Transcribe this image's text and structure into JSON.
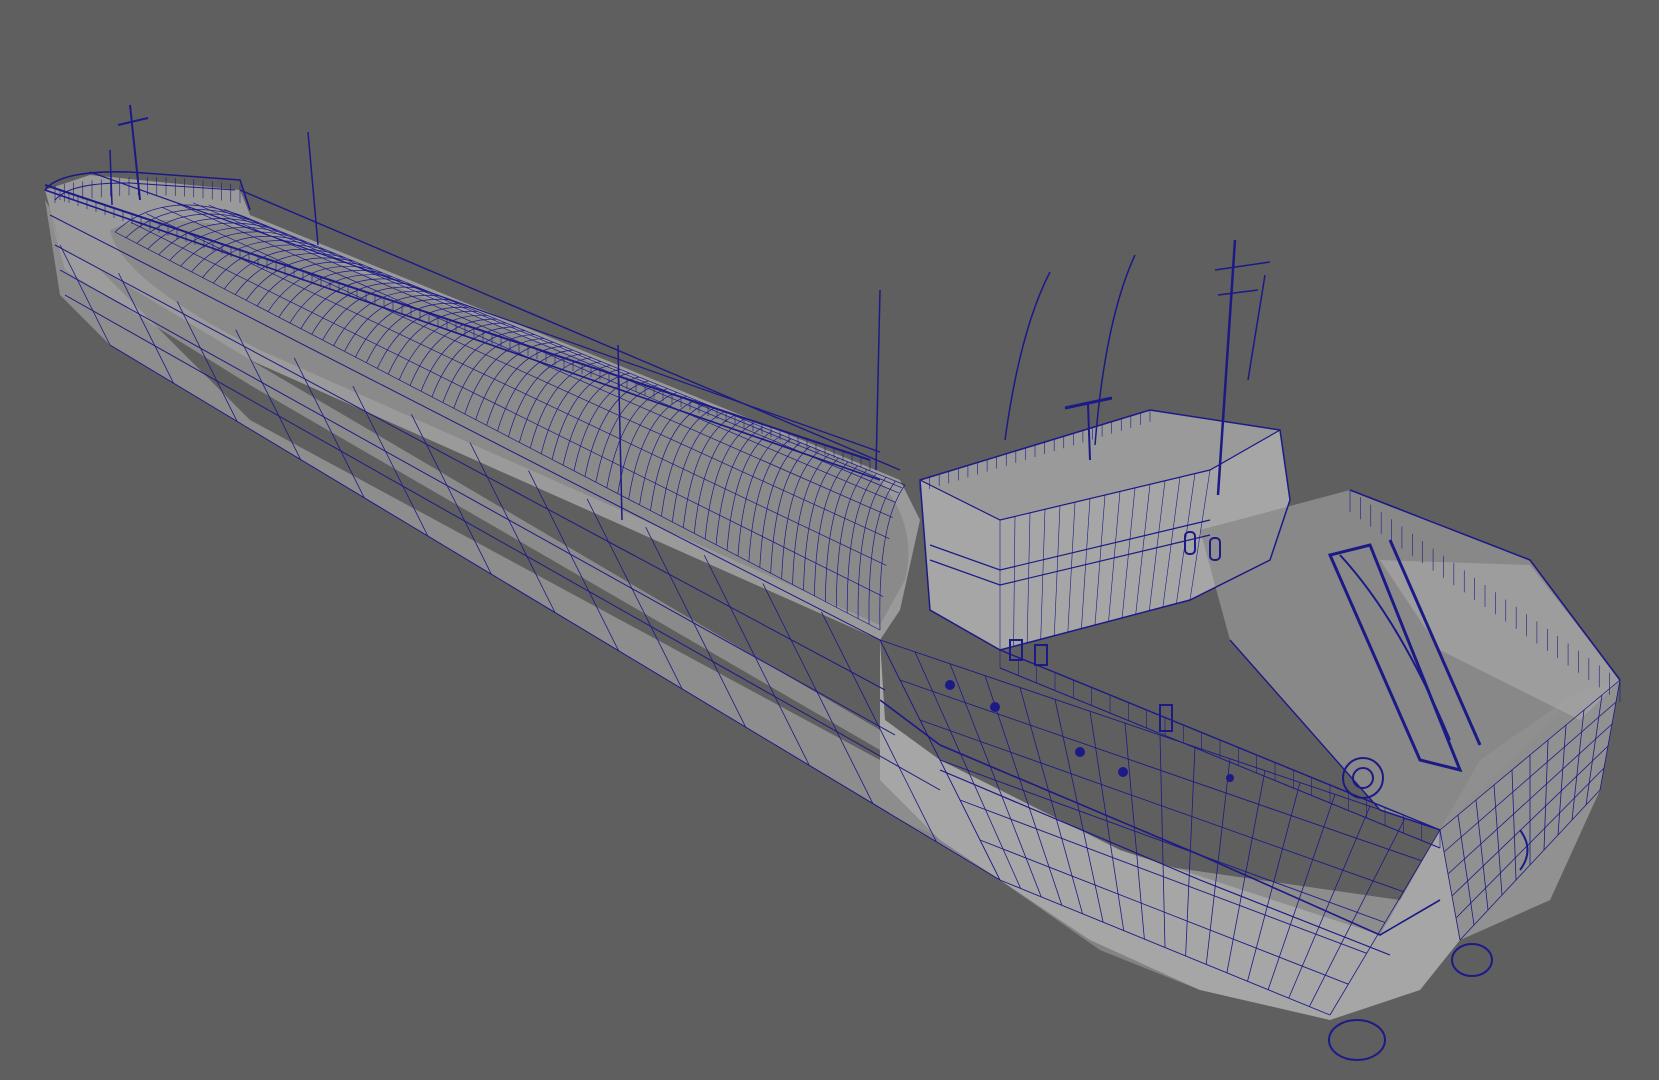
{
  "viewport": {
    "background_color": "#5f5f5f",
    "wireframe_color": "#1c1a86",
    "shaded_color": "#8d8d8d",
    "model": "cargo-ship-wireframe"
  }
}
